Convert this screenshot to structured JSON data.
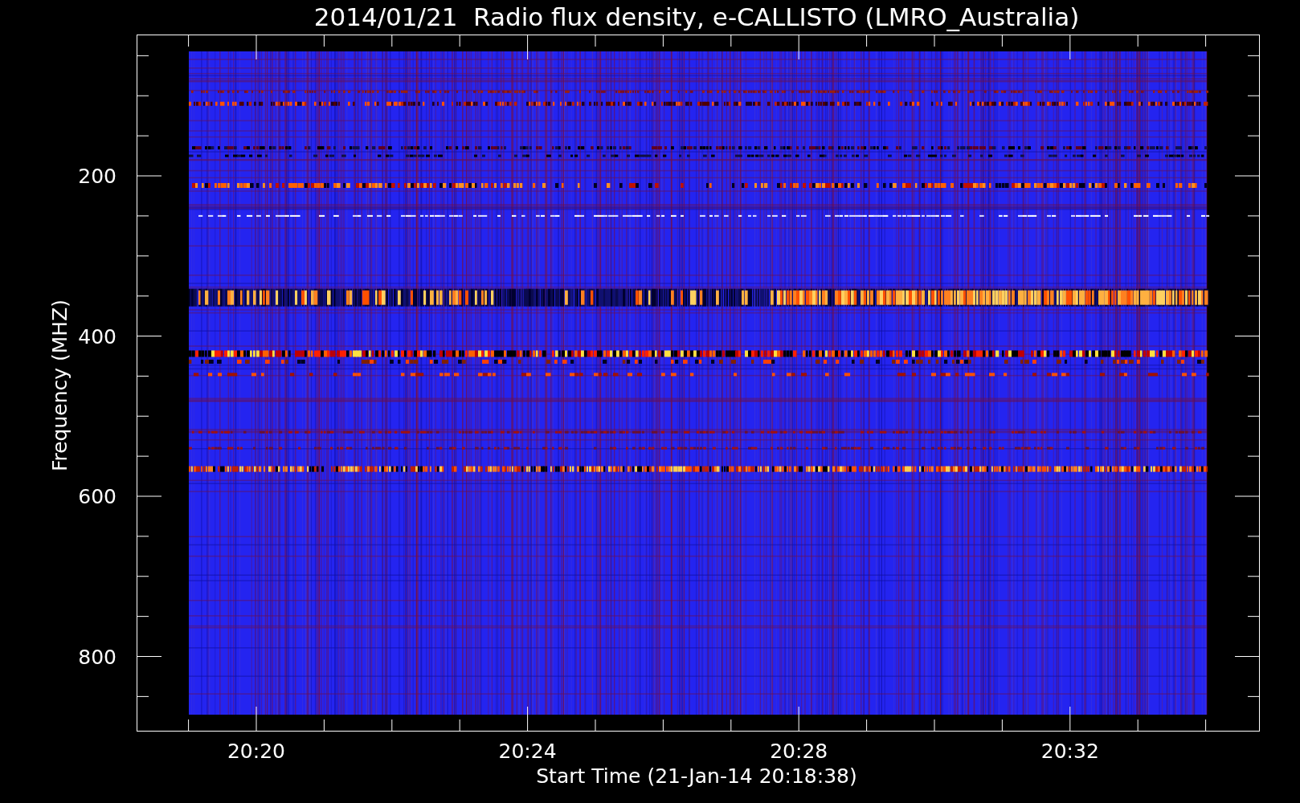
{
  "title": "2014/01/21  Radio flux density, e-CALLISTO (LMRO_Australia)",
  "y_axis": {
    "label": "Frequency (MHZ)",
    "tick_labels": [
      "200",
      "400",
      "600",
      "800"
    ]
  },
  "x_axis": {
    "label": "Start Time (21-Jan-14 20:18:38)",
    "tick_labels": [
      "20:20",
      "20:24",
      "20:28",
      "20:32"
    ]
  }
}
